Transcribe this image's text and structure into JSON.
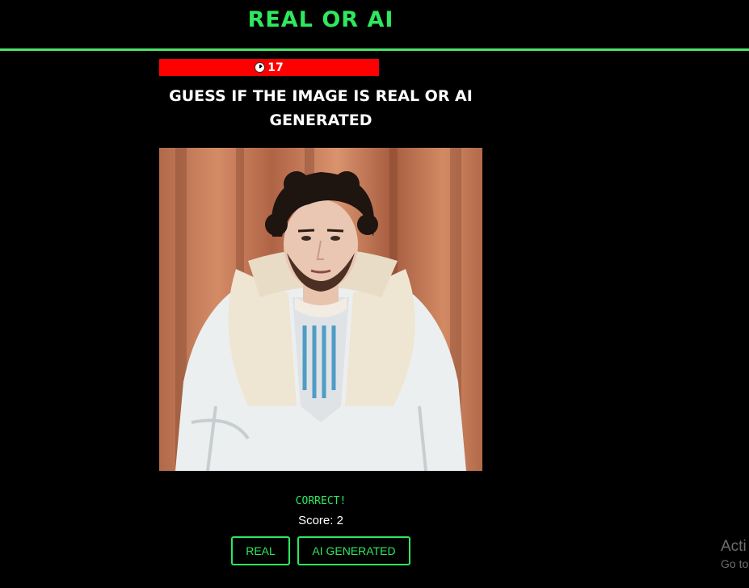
{
  "header": {
    "title": "REAL OR AI"
  },
  "timer": {
    "value": "17",
    "icon": "clock-icon",
    "bar_color": "#ff0000"
  },
  "prompt": {
    "text": "GUESS IF THE IMAGE IS REAL OR AI GENERATED"
  },
  "image": {
    "alt": "portrait photo"
  },
  "result": {
    "feedback": "CORRECT!",
    "score_label": "Score: 2"
  },
  "buttons": {
    "real_label": "REAL",
    "ai_label": "AI GENERATED"
  },
  "watermark": {
    "title": "Acti",
    "subtitle": "Go to"
  },
  "colors": {
    "accent": "#2ee85e",
    "background": "#000000",
    "timer": "#ff0000"
  }
}
